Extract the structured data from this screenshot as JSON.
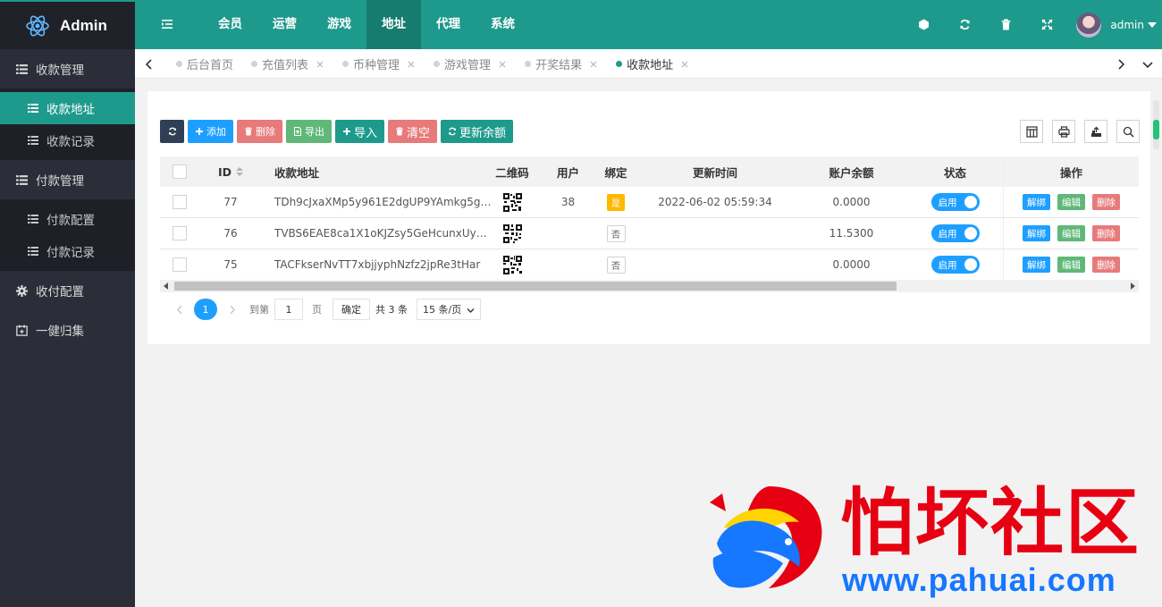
{
  "app": {
    "brand": "Admin",
    "username": "admin"
  },
  "top_nav": [
    {
      "label": "会员"
    },
    {
      "label": "运营"
    },
    {
      "label": "游戏"
    },
    {
      "label": "地址",
      "active": true
    },
    {
      "label": "代理"
    },
    {
      "label": "系统"
    }
  ],
  "header_icons": [
    "cube-icon",
    "refresh-icon",
    "trash-icon",
    "fullscreen-icon"
  ],
  "sidebar": {
    "groups": [
      {
        "label": "收款管理",
        "icon": "list-icon",
        "items": [
          {
            "label": "收款地址",
            "active": true
          },
          {
            "label": "收款记录"
          }
        ]
      },
      {
        "label": "付款管理",
        "icon": "list-icon",
        "items": [
          {
            "label": "付款配置"
          },
          {
            "label": "付款记录"
          }
        ]
      },
      {
        "label": "收付配置",
        "icon": "gear-icon",
        "items": []
      },
      {
        "label": "一健归集",
        "icon": "calendar-icon",
        "items": []
      }
    ]
  },
  "tabs": [
    {
      "label": "后台首页",
      "closable": false
    },
    {
      "label": "充值列表",
      "closable": true
    },
    {
      "label": "币种管理",
      "closable": true
    },
    {
      "label": "游戏管理",
      "closable": true
    },
    {
      "label": "开奖结果",
      "closable": true
    },
    {
      "label": "收款地址",
      "closable": true,
      "active": true
    }
  ],
  "toolbar": {
    "add": "添加",
    "delete": "删除",
    "export": "导出",
    "import": "导入",
    "clear": "清空",
    "update_balance": "更新余额"
  },
  "table": {
    "headers": {
      "id": "ID",
      "address": "收款地址",
      "qr": "二维码",
      "user": "用户",
      "bind": "绑定",
      "updated": "更新时间",
      "balance": "账户余额",
      "status": "状态",
      "ops": "操作"
    },
    "rows": [
      {
        "id": "77",
        "address": "TDh9cJxaXMp5y961E2dgUP9YAmkg5g…",
        "user": "38",
        "bind": "是",
        "updated": "2022-06-02 05:59:34",
        "balance": "0.0000",
        "status": "启用"
      },
      {
        "id": "76",
        "address": "TVBS6EAE8ca1X1oKJZsy5GeHcunxUy…",
        "user": "",
        "bind": "否",
        "updated": "",
        "balance": "11.5300",
        "status": "启用"
      },
      {
        "id": "75",
        "address": "TACFkserNvTT7xbjjyphNzfz2jpRe3tHar",
        "user": "",
        "bind": "否",
        "updated": "",
        "balance": "0.0000",
        "status": "启用"
      }
    ],
    "op_labels": {
      "unbind": "解绑",
      "edit": "编辑",
      "delete": "删除"
    }
  },
  "pager": {
    "current": "1",
    "goto_label": "到第",
    "page_unit": "页",
    "confirm": "确定",
    "total": "共 3 条",
    "page_size": "15 条/页"
  },
  "watermark": {
    "title": "怕坏社区",
    "url": "www.pahuai.com"
  },
  "colors": {
    "primary": "#1e9a8c",
    "sidebar": "#2b2e38",
    "blue": "#1e9fff",
    "red": "#e77a7a",
    "green": "#5fb878",
    "yellow": "#ffb800"
  }
}
